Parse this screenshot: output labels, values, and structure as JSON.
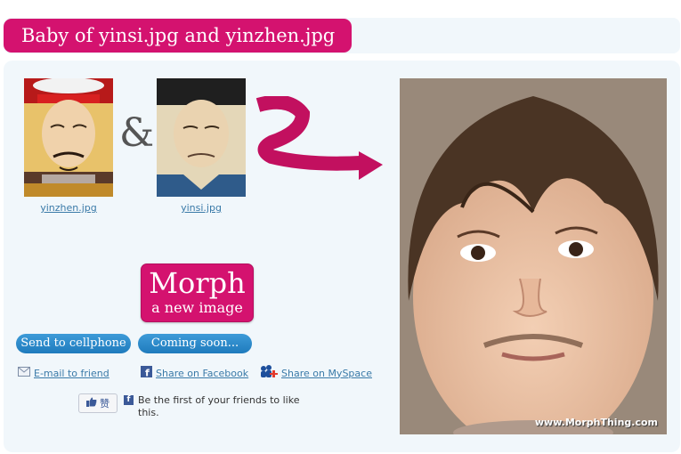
{
  "header": {
    "title": "Baby of yinsi.jpg and yinzhen.jpg"
  },
  "parents": [
    {
      "label": "yinzhen.jpg",
      "image": "emperor-portrait-red-hat"
    },
    {
      "label": "yinsi.jpg",
      "image": "portrait-black-cap"
    }
  ],
  "joiner": "&",
  "morph_button": {
    "line1": "Morph",
    "line2": "a new image"
  },
  "buttons": {
    "cellphone": "Send to cellphone",
    "coming_soon": "Coming soon..."
  },
  "share": {
    "email": "E-mail to friend",
    "facebook": "Share on Facebook",
    "myspace": "Share on MySpace"
  },
  "facebook_like": {
    "button_label": "赞",
    "text": "Be the first of your friends to like this."
  },
  "result": {
    "watermark": "www.MorphThing.com"
  },
  "colors": {
    "accent": "#d4126f",
    "link": "#3a7aa8",
    "button_blue": "#2a88c8",
    "panel": "#f1f7fb"
  }
}
